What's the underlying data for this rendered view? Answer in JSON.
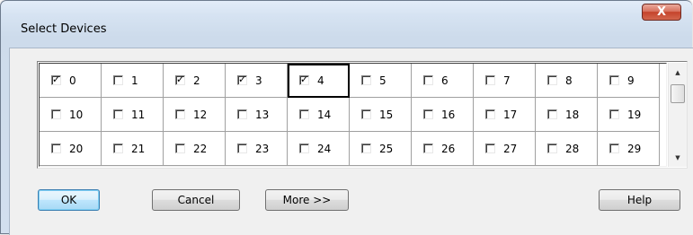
{
  "window": {
    "title": "Select Devices",
    "close_label": "X"
  },
  "devices": [
    {
      "label": "0",
      "checked": true
    },
    {
      "label": "1",
      "checked": false
    },
    {
      "label": "2",
      "checked": true
    },
    {
      "label": "3",
      "checked": true
    },
    {
      "label": "4",
      "checked": true,
      "focused": true
    },
    {
      "label": "5",
      "checked": false
    },
    {
      "label": "6",
      "checked": false
    },
    {
      "label": "7",
      "checked": false
    },
    {
      "label": "8",
      "checked": false
    },
    {
      "label": "9",
      "checked": false
    },
    {
      "label": "10",
      "checked": false
    },
    {
      "label": "11",
      "checked": false
    },
    {
      "label": "12",
      "checked": false
    },
    {
      "label": "13",
      "checked": false
    },
    {
      "label": "14",
      "checked": false
    },
    {
      "label": "15",
      "checked": false
    },
    {
      "label": "16",
      "checked": false
    },
    {
      "label": "17",
      "checked": false
    },
    {
      "label": "18",
      "checked": false
    },
    {
      "label": "19",
      "checked": false
    },
    {
      "label": "20",
      "checked": false
    },
    {
      "label": "21",
      "checked": false
    },
    {
      "label": "22",
      "checked": false
    },
    {
      "label": "23",
      "checked": false
    },
    {
      "label": "24",
      "checked": false
    },
    {
      "label": "25",
      "checked": false
    },
    {
      "label": "26",
      "checked": false
    },
    {
      "label": "27",
      "checked": false
    },
    {
      "label": "28",
      "checked": false
    },
    {
      "label": "29",
      "checked": false
    }
  ],
  "scrollbar": {
    "up_icon": "arrow-up-icon",
    "down_icon": "arrow-down-icon"
  },
  "buttons": {
    "ok": "OK",
    "cancel": "Cancel",
    "more": "More >>",
    "help": "Help"
  },
  "colors": {
    "close_button": "#c5432b",
    "default_button_border": "#3c7fb1"
  }
}
